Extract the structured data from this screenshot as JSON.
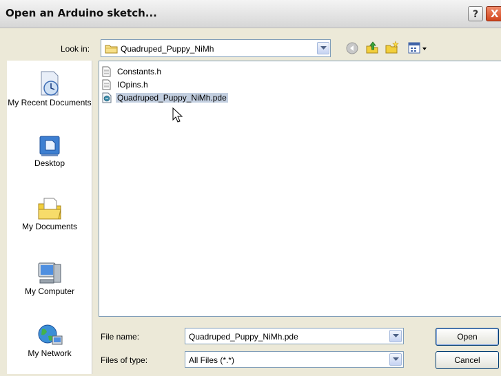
{
  "window": {
    "title": "Open an Arduino sketch...",
    "help_glyph": "?",
    "close_glyph": "X"
  },
  "look_in": {
    "label": "Look in:",
    "value": "Quadruped_Puppy_NiMh",
    "toolbar_icons": [
      "back-icon",
      "up-folder-icon",
      "new-folder-icon",
      "view-menu-icon"
    ]
  },
  "places": [
    {
      "label": "My Recent Documents",
      "icon": "recent-documents-icon"
    },
    {
      "label": "Desktop",
      "icon": "desktop-icon"
    },
    {
      "label": "My Documents",
      "icon": "my-documents-icon"
    },
    {
      "label": "My Computer",
      "icon": "my-computer-icon"
    },
    {
      "label": "My Network",
      "icon": "my-network-icon"
    }
  ],
  "files": [
    {
      "name": "Constants.h",
      "icon": "text-file-icon",
      "selected": false
    },
    {
      "name": "IOpins.h",
      "icon": "text-file-icon",
      "selected": false
    },
    {
      "name": "Quadruped_Puppy_NiMh.pde",
      "icon": "sketch-file-icon",
      "selected": true
    }
  ],
  "file_name": {
    "label": "File name:",
    "value": "Quadruped_Puppy_NiMh.pde"
  },
  "files_of_type": {
    "label": "Files of type:",
    "value": "All Files (*.*)"
  },
  "buttons": {
    "open": "Open",
    "cancel": "Cancel"
  },
  "colors": {
    "selection": "#c3cfe0",
    "field_border": "#7f9db9",
    "dialog_bg": "#ece9d8",
    "close_red": "#d0441c"
  }
}
